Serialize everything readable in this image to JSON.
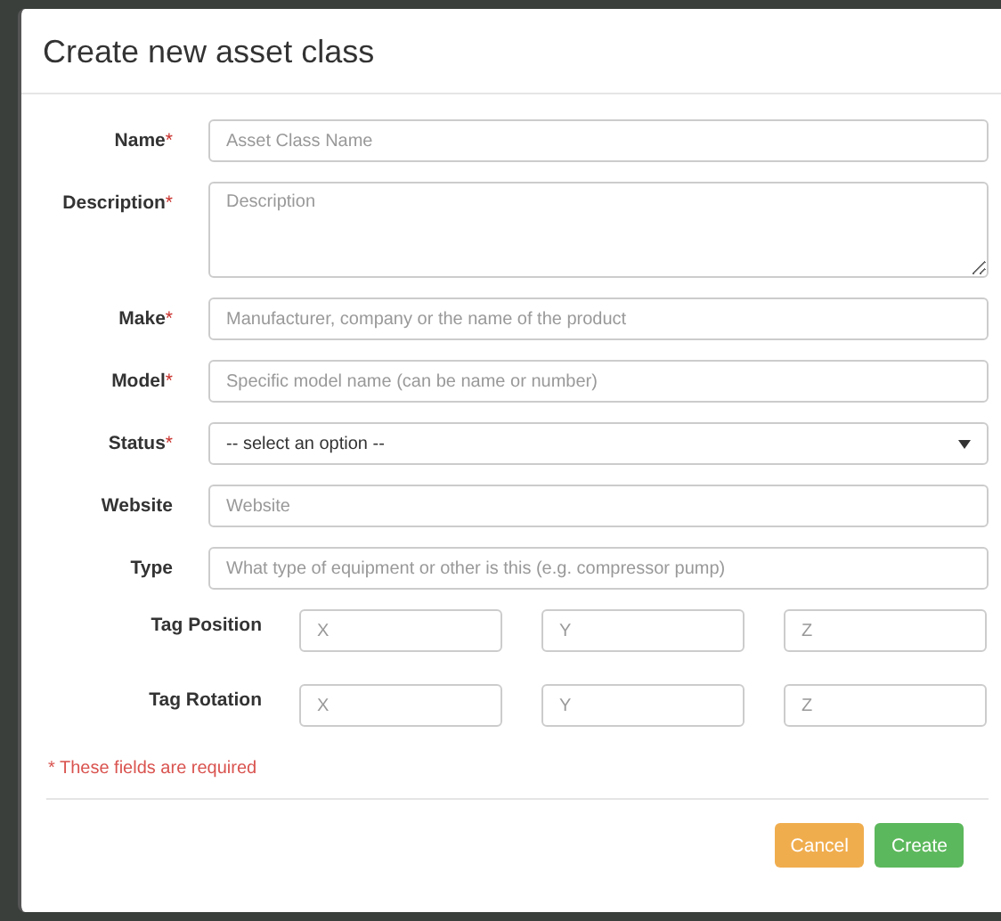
{
  "dialog": {
    "title": "Create new asset class"
  },
  "fields": [
    {
      "label": "Name",
      "required_mark": "*",
      "kind": "input",
      "placeholder": "Asset Class Name"
    },
    {
      "label": "Description",
      "required_mark": "*",
      "kind": "textarea",
      "placeholder": "Description"
    },
    {
      "label": "Make",
      "required_mark": "*",
      "kind": "input",
      "placeholder": "Manufacturer, company or the name of the product"
    },
    {
      "label": "Model",
      "required_mark": "*",
      "kind": "input",
      "placeholder": "Specific model name (can be name or number)"
    },
    {
      "label": "Status",
      "required_mark": "*",
      "kind": "select",
      "value": "-- select an option --"
    },
    {
      "label": "Website",
      "kind": "input",
      "placeholder": "Website"
    },
    {
      "label": "Type",
      "kind": "input",
      "placeholder": "What type of equipment or other is this (e.g. compressor pump)"
    }
  ],
  "vector_fields": [
    {
      "label": "Tag Position",
      "placeholders": [
        "X",
        "Y",
        "Z"
      ]
    },
    {
      "label": "Tag Rotation",
      "placeholders": [
        "X",
        "Y",
        "Z"
      ]
    }
  ],
  "required_note": "* These fields are required",
  "buttons": [
    {
      "label": "Cancel",
      "kind": "warning"
    },
    {
      "label": "Create",
      "kind": "success"
    }
  ]
}
